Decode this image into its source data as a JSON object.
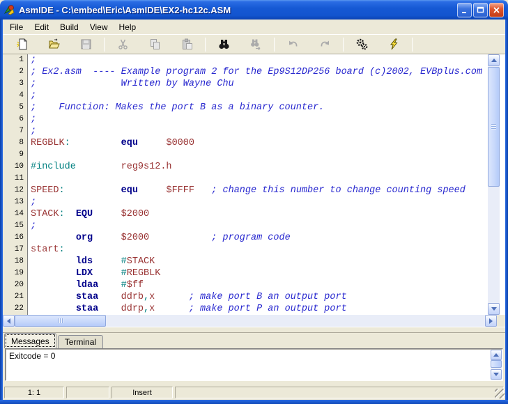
{
  "window": {
    "title": "AsmIDE - C:\\embed\\Eric\\AsmIDE\\EX2-hc12c.ASM"
  },
  "menu": {
    "items": [
      "File",
      "Edit",
      "Build",
      "View",
      "Help"
    ]
  },
  "toolbar": {
    "buttons": [
      {
        "name": "new-file",
        "icon": "new",
        "enabled": true
      },
      {
        "name": "open-file",
        "icon": "open",
        "enabled": true
      },
      {
        "name": "save-file",
        "icon": "save",
        "enabled": false
      },
      {
        "type": "sep"
      },
      {
        "name": "cut",
        "icon": "cut",
        "enabled": false
      },
      {
        "name": "copy",
        "icon": "copy",
        "enabled": false
      },
      {
        "name": "paste",
        "icon": "paste",
        "enabled": false
      },
      {
        "type": "sep"
      },
      {
        "name": "find",
        "icon": "find",
        "enabled": true
      },
      {
        "name": "find-next",
        "icon": "findnext",
        "enabled": false
      },
      {
        "type": "sep"
      },
      {
        "name": "undo",
        "icon": "undo",
        "enabled": false
      },
      {
        "name": "redo",
        "icon": "redo",
        "enabled": false
      },
      {
        "type": "sep"
      },
      {
        "name": "assemble",
        "icon": "build",
        "enabled": true
      },
      {
        "name": "download",
        "icon": "lightning",
        "enabled": true
      },
      {
        "type": "sep"
      }
    ]
  },
  "editor": {
    "lines": [
      {
        "num": 1,
        "segs": [
          [
            ";",
            "c"
          ]
        ]
      },
      {
        "num": 2,
        "segs": [
          [
            "; Ex2.asm  ---- Example program 2 for the Ep9S12DP256 board (c)2002, EVBplus.com",
            "c"
          ]
        ]
      },
      {
        "num": 3,
        "segs": [
          [
            ";               Written by Wayne Chu",
            "c"
          ]
        ]
      },
      {
        "num": 4,
        "segs": [
          [
            ";",
            "c"
          ]
        ]
      },
      {
        "num": 5,
        "segs": [
          [
            ";    Function: Makes the port B as a binary counter.",
            "c"
          ]
        ]
      },
      {
        "num": 6,
        "segs": [
          [
            ";",
            "c"
          ]
        ]
      },
      {
        "num": 7,
        "segs": [
          [
            ";",
            "c"
          ]
        ]
      },
      {
        "num": 8,
        "segs": [
          [
            "REGBLK",
            "m"
          ],
          [
            ":",
            "p"
          ],
          [
            "         ",
            "t"
          ],
          [
            "equ",
            "k"
          ],
          [
            "     ",
            "t"
          ],
          [
            "$0000",
            "m"
          ]
        ]
      },
      {
        "num": 9,
        "segs": []
      },
      {
        "num": 10,
        "segs": [
          [
            "#include",
            "p"
          ],
          [
            "        ",
            "t"
          ],
          [
            "reg9s12.h",
            "m"
          ]
        ]
      },
      {
        "num": 11,
        "segs": []
      },
      {
        "num": 12,
        "segs": [
          [
            "SPEED",
            "m"
          ],
          [
            ":",
            "p"
          ],
          [
            "          ",
            "t"
          ],
          [
            "equ",
            "k"
          ],
          [
            "     ",
            "t"
          ],
          [
            "$FFFF",
            "m"
          ],
          [
            "   ",
            "t"
          ],
          [
            "; change this number to change counting speed",
            "c"
          ]
        ]
      },
      {
        "num": 13,
        "segs": [
          [
            ";",
            "c"
          ]
        ]
      },
      {
        "num": 14,
        "segs": [
          [
            "STACK",
            "m"
          ],
          [
            ":",
            "p"
          ],
          [
            "  ",
            "t"
          ],
          [
            "EQU",
            "k"
          ],
          [
            "     ",
            "t"
          ],
          [
            "$2000",
            "m"
          ]
        ]
      },
      {
        "num": 15,
        "segs": [
          [
            ";",
            "c"
          ]
        ]
      },
      {
        "num": 16,
        "segs": [
          [
            "        ",
            "t"
          ],
          [
            "org",
            "k"
          ],
          [
            "     ",
            "t"
          ],
          [
            "$2000",
            "m"
          ],
          [
            "           ",
            "t"
          ],
          [
            "; program code",
            "c"
          ]
        ]
      },
      {
        "num": 17,
        "segs": [
          [
            "start",
            "m"
          ],
          [
            ":",
            "p"
          ]
        ]
      },
      {
        "num": 18,
        "segs": [
          [
            "        ",
            "t"
          ],
          [
            "lds",
            "k"
          ],
          [
            "     ",
            "t"
          ],
          [
            "#",
            "p"
          ],
          [
            "STACK",
            "m"
          ]
        ]
      },
      {
        "num": 19,
        "segs": [
          [
            "        ",
            "t"
          ],
          [
            "LDX",
            "k"
          ],
          [
            "     ",
            "t"
          ],
          [
            "#",
            "p"
          ],
          [
            "REGBLK",
            "m"
          ]
        ]
      },
      {
        "num": 20,
        "segs": [
          [
            "        ",
            "t"
          ],
          [
            "ldaa",
            "k"
          ],
          [
            "    ",
            "t"
          ],
          [
            "#",
            "p"
          ],
          [
            "$ff",
            "m"
          ]
        ]
      },
      {
        "num": 21,
        "segs": [
          [
            "        ",
            "t"
          ],
          [
            "staa",
            "k"
          ],
          [
            "    ",
            "t"
          ],
          [
            "ddrb",
            "m"
          ],
          [
            ",",
            "p"
          ],
          [
            "x",
            "m"
          ],
          [
            "      ",
            "t"
          ],
          [
            "; make port B an output port",
            "c"
          ]
        ]
      },
      {
        "num": 22,
        "segs": [
          [
            "        ",
            "t"
          ],
          [
            "staa",
            "k"
          ],
          [
            "    ",
            "t"
          ],
          [
            "ddrp",
            "m"
          ],
          [
            ",",
            "p"
          ],
          [
            "x",
            "m"
          ],
          [
            "      ",
            "t"
          ],
          [
            "; make port P an output port",
            "c"
          ]
        ]
      }
    ]
  },
  "tabs": [
    {
      "label": "Messages",
      "active": true
    },
    {
      "label": "Terminal",
      "active": false
    }
  ],
  "messages": {
    "text": "Exitcode = 0"
  },
  "statusbar": {
    "panels": [
      "1: 1",
      "",
      "Insert",
      ""
    ]
  },
  "colors": {
    "comment": "#2828CF",
    "keyword": "#00008B",
    "identifier": "#993333",
    "punct": "#008080",
    "titlebar_blue": "#1659D4",
    "chrome": "#ECE9D8"
  }
}
